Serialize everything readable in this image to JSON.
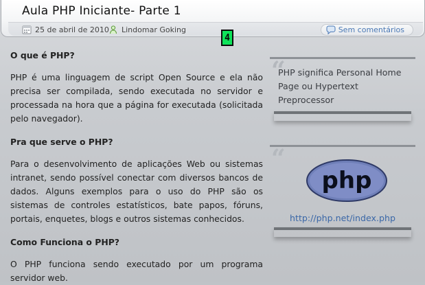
{
  "post": {
    "title": "Aula PHP Iniciante- Parte 1",
    "date": "25 de abril de 2010",
    "author": "Lindomar Goking",
    "comments_label": "Sem comentários"
  },
  "badge": {
    "number": "4",
    "color": "#0fe35a"
  },
  "icons": {
    "calendar": "calendar-icon",
    "user": "user-icon",
    "comment": "comment-bubble-icon",
    "quote": "quote-mark-icon",
    "php_logo": "php-logo"
  },
  "article": {
    "sections": [
      {
        "heading": "O que é PHP?",
        "paragraph": "PHP é uma linguagem de script Open Source e ela não precisa ser compilada, sendo executada no servidor e processada na hora que a página for executada (solicitada pelo navegador)."
      },
      {
        "heading": "Pra que serve o PHP?",
        "paragraph": "Para o desenvolvimento de aplicações Web ou sistemas intranet, sendo possível conectar com diversos bancos de dados. Alguns exemplos para o uso do PHP são os sistemas de controles estatísticos, bate papos, fóruns, portais, enquetes, blogs e outros sistemas conhecidos."
      },
      {
        "heading": "Como Funciona o PHP?",
        "paragraph": "O PHP funciona sendo executado por um programa servidor web."
      }
    ]
  },
  "sidebar": {
    "quote1_text": "PHP significa Personal Home Page ou Hypertext Preprocessor",
    "quote2_link": "http://php.net/index.php",
    "php_logo_text": "php"
  },
  "colors": {
    "link": "#3a67a7",
    "accent_gray": "#8d9196"
  }
}
